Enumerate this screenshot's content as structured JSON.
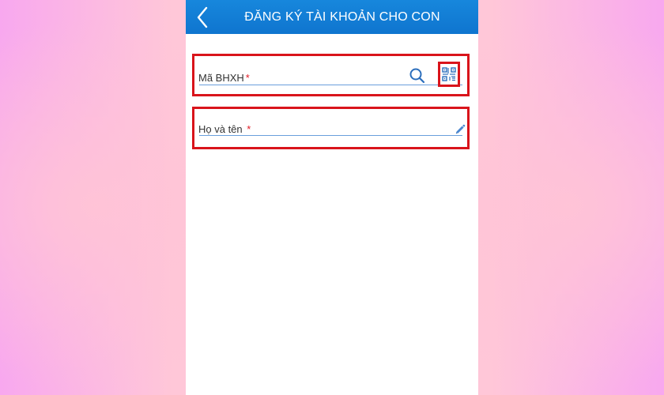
{
  "header": {
    "title": "ĐĂNG KÝ TÀI KHOẢN CHO CON",
    "back_icon": "chevron-left-icon"
  },
  "form": {
    "social_insurance": {
      "label": "Mã BHXH",
      "required_mark": "*",
      "value": "",
      "search_icon": "search-icon",
      "qr_icon": "qr-code-icon"
    },
    "full_name": {
      "label": "Họ và tên",
      "required_mark": "*",
      "value": "",
      "edit_icon": "pencil-icon"
    }
  },
  "colors": {
    "header_blue": "#1787dc",
    "highlight_red": "#d9141b",
    "input_line_blue": "#6a9fdc",
    "required_red": "#e11b24",
    "background_pink": "#ffc7d8",
    "background_magenta": "#f8a8ef"
  }
}
